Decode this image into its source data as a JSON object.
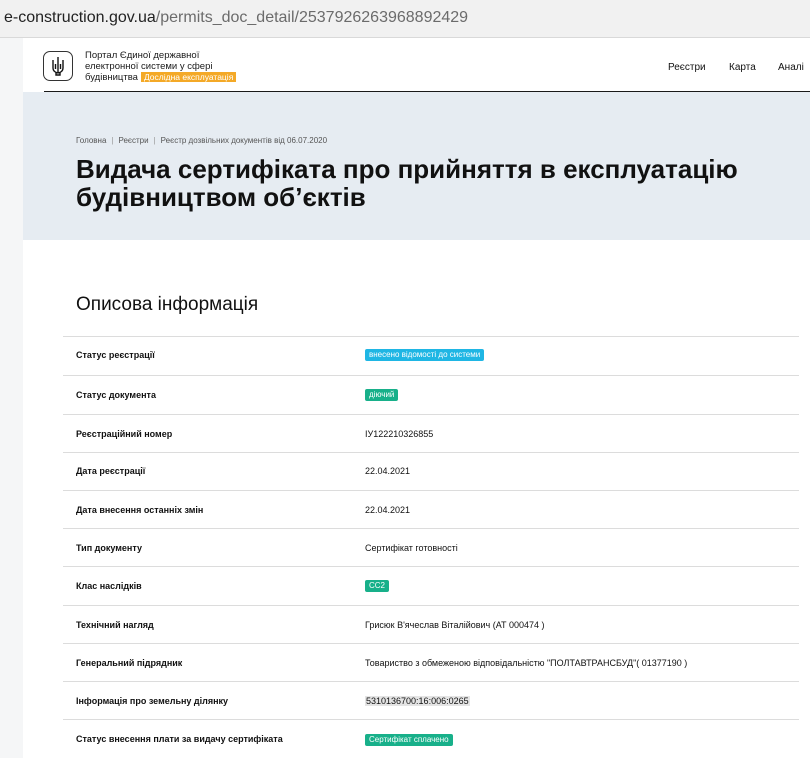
{
  "browser": {
    "url_host": "e-construction.gov.ua",
    "url_path": "/permits_doc_detail/2537926263968892429"
  },
  "header": {
    "portal_title_lines": [
      "Портал Єдиної державної",
      "електронної системи у сфері",
      "будівництва"
    ],
    "beta_label": "Дослідна експлуатація",
    "nav": [
      "Реєстри",
      "Карта",
      "Аналі"
    ]
  },
  "breadcrumb": [
    "Головна",
    "Реєстри",
    "Реєстр дозвільних документів від 06.07.2020"
  ],
  "page_title_lines": [
    "Видача сертифіката про прийняття в експлуатацію",
    "будівництвом об’єктів"
  ],
  "section_title": "Описова інформація",
  "colors": {
    "badge_blue": "#1fb6e4",
    "badge_green": "#18b08a",
    "beta_badge": "#f4a927",
    "hero_bg": "#e6ecf2"
  },
  "rows": [
    {
      "label": "Статус реєстрації",
      "value": "внесено відомості до системи",
      "type": "badge",
      "color": "blue"
    },
    {
      "label": "Статус документа",
      "value": "діючий",
      "type": "badge",
      "color": "green"
    },
    {
      "label": "Реєстраційний номер",
      "value": "ІУ122210326855",
      "type": "text"
    },
    {
      "label": "Дата реєстрації",
      "value": "22.04.2021",
      "type": "text"
    },
    {
      "label": "Дата внесення останніх змін",
      "value": "22.04.2021",
      "type": "text"
    },
    {
      "label": "Тип документу",
      "value": "Сертифікат готовності",
      "type": "text"
    },
    {
      "label": "Клас наслідків",
      "value": "СС2",
      "type": "badge",
      "color": "green"
    },
    {
      "label": "Технічний нагляд",
      "value": "Грисюк В'ячеслав Віталійович (АТ 000474 )",
      "type": "text"
    },
    {
      "label": "Генеральний підрядник",
      "value": "Товариство з обмеженою відповідальністю \"ПОЛТАВТРАНСБУД\"( 01377190 )",
      "type": "text"
    },
    {
      "label": "Інформація про земельну ділянку",
      "value": "5310136700:16:006:0265",
      "type": "highlight"
    },
    {
      "label": "Статус внесення плати за видачу сертифіката",
      "value": "Сертифікат сплачено",
      "type": "badge",
      "color": "green"
    }
  ]
}
